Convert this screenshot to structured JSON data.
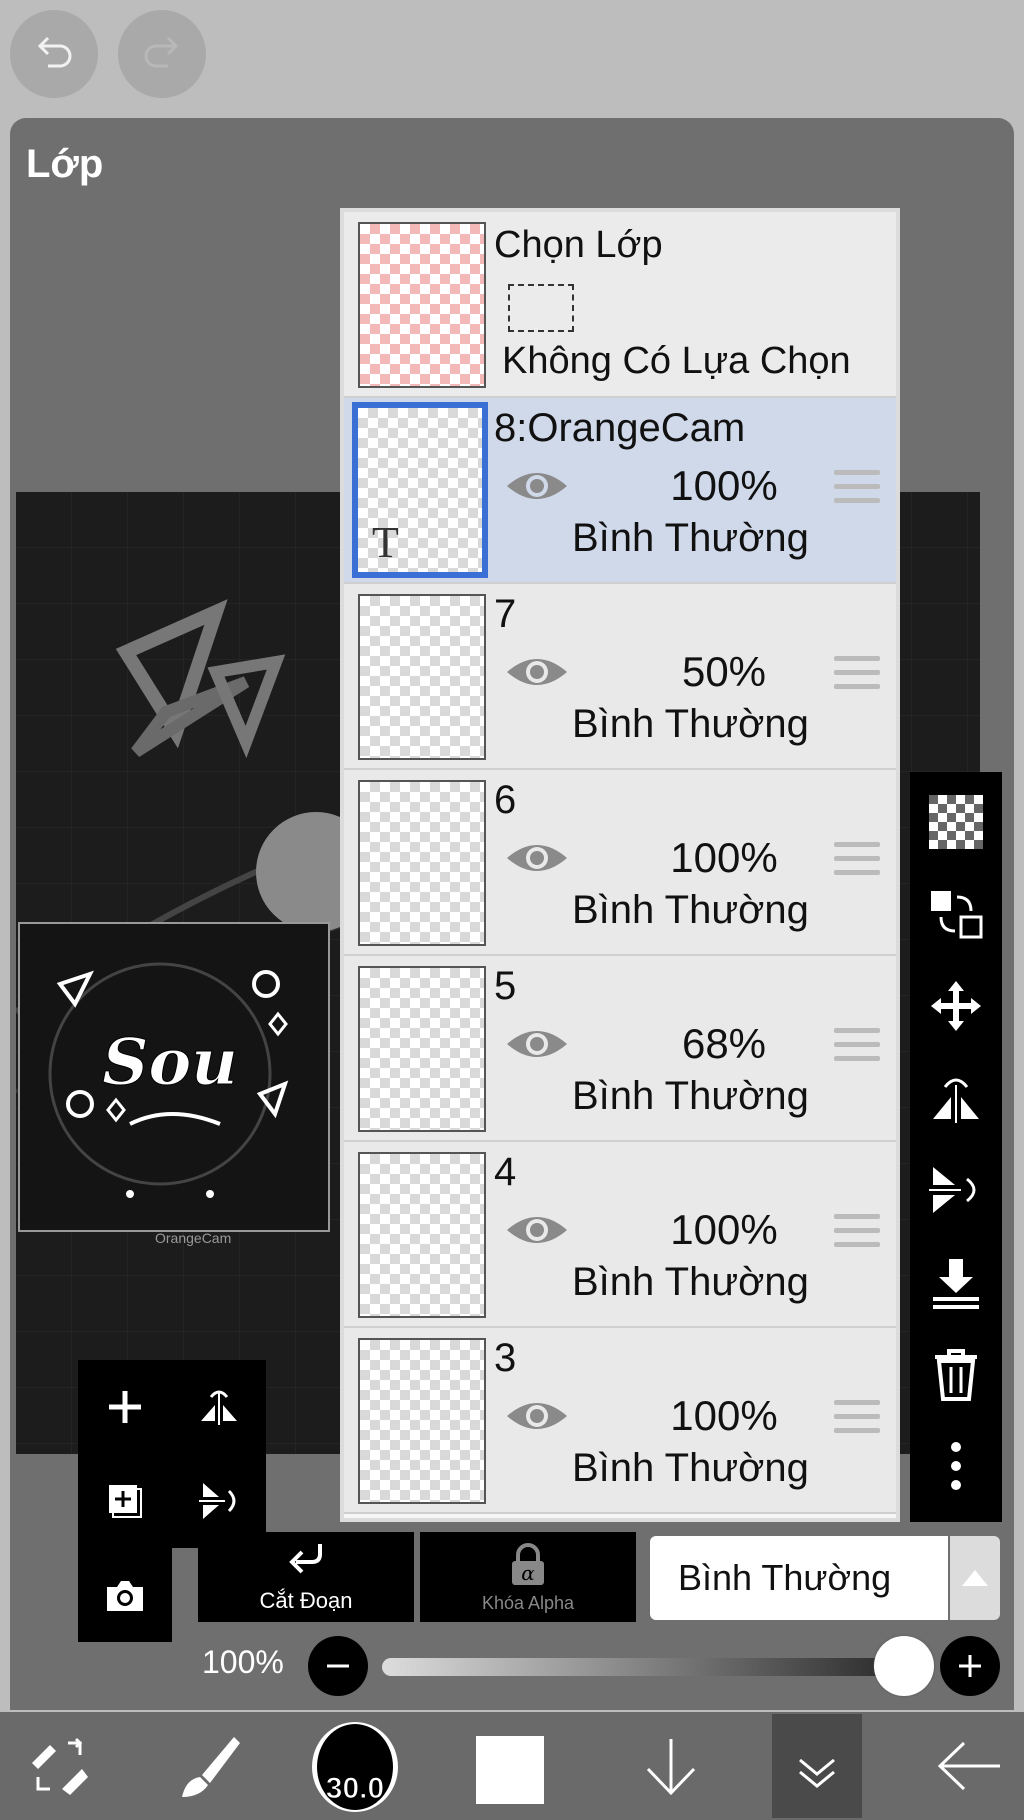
{
  "toolbar": {
    "undo_icon": "undo-icon",
    "redo_icon": "redo-icon"
  },
  "panel": {
    "title": "Lớp"
  },
  "canvas": {
    "watermark": "OrangeCam"
  },
  "selection_layer": {
    "title": "Chọn Lớp",
    "status": "Không Có Lựa Chọn"
  },
  "layers": [
    {
      "name": "8:OrangeCam",
      "opacity": "100%",
      "blend": "Bình Thường",
      "type": "text",
      "active": true,
      "visible": true
    },
    {
      "name": "7",
      "opacity": "50%",
      "blend": "Bình Thường",
      "active": false,
      "visible": true
    },
    {
      "name": "6",
      "opacity": "100%",
      "blend": "Bình Thường",
      "active": false,
      "visible": true
    },
    {
      "name": "5",
      "opacity": "68%",
      "blend": "Bình Thường",
      "active": false,
      "visible": true
    },
    {
      "name": "4",
      "opacity": "100%",
      "blend": "Bình Thường",
      "active": false,
      "visible": true
    },
    {
      "name": "3",
      "opacity": "100%",
      "blend": "Bình Thường",
      "active": false,
      "visible": true
    }
  ],
  "text_layer_glyph": "T",
  "actions": {
    "clip_label": "Cắt Đoạn",
    "alpha_lock_label": "Khóa Alpha",
    "blend_mode": "Bình Thường"
  },
  "opacity_control": {
    "label": "100%",
    "value": 1.0
  },
  "brush": {
    "size": "30.0"
  },
  "colors": {
    "accent": "#3a6fd6",
    "active_row": "#d0d9ea",
    "panel_bg": "#6f6f6f",
    "primary_color": "#ffffff"
  }
}
